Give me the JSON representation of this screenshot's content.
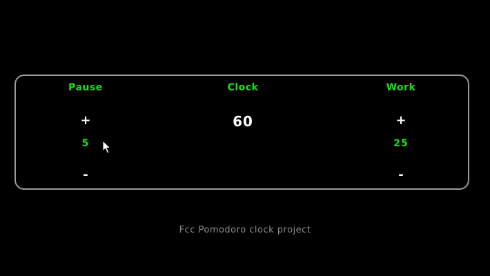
{
  "pause": {
    "title": "Pause",
    "plus_label": "+",
    "value": "5",
    "minus_label": "-"
  },
  "clock": {
    "title": "Clock",
    "value": "60"
  },
  "work": {
    "title": "Work",
    "plus_label": "+",
    "value": "25",
    "minus_label": "-"
  },
  "footer": {
    "text": "Fcc Pomodoro clock project"
  },
  "colors": {
    "background": "#000000",
    "accent_green": "#18e018",
    "panel_border": "#9a9a9a",
    "footer_text": "#8c8c8c"
  },
  "icons": {
    "cursor": "mouse-pointer-icon"
  }
}
